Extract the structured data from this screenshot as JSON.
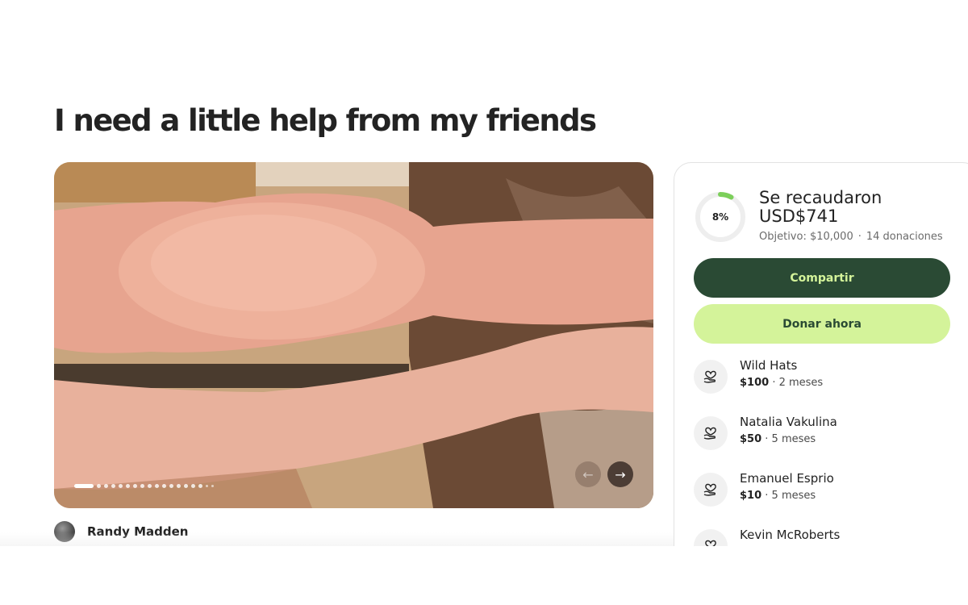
{
  "campaign": {
    "title": "I need a little help from my friends",
    "organizer": "Randy Madden"
  },
  "gallery": {
    "slide_count": 18,
    "active_index": 0,
    "prev_icon": "arrow-left-icon",
    "next_icon": "arrow-right-icon"
  },
  "progress": {
    "percent_label": "8%",
    "fraction": 0.08,
    "raised_label": "Se recaudaron USD$741",
    "goal_label": "Objetivo: $10,000",
    "separator": "·",
    "donations_label": "14 donaciones"
  },
  "actions": {
    "share_label": "Compartir",
    "donate_label": "Donar ahora"
  },
  "donors": [
    {
      "name": "Wild Hats",
      "amount": "$100",
      "time": " · 2 meses"
    },
    {
      "name": "Natalia Vakulina",
      "amount": "$50",
      "time": " · 5 meses"
    },
    {
      "name": "Emanuel Esprio",
      "amount": "$10",
      "time": " · 5 meses"
    },
    {
      "name": "Kevin McRoberts",
      "amount": "",
      "time": ""
    }
  ],
  "colors": {
    "brand_dark": "#2a4a34",
    "brand_light": "#d4f39a",
    "progress_green": "#7ccf5a"
  }
}
